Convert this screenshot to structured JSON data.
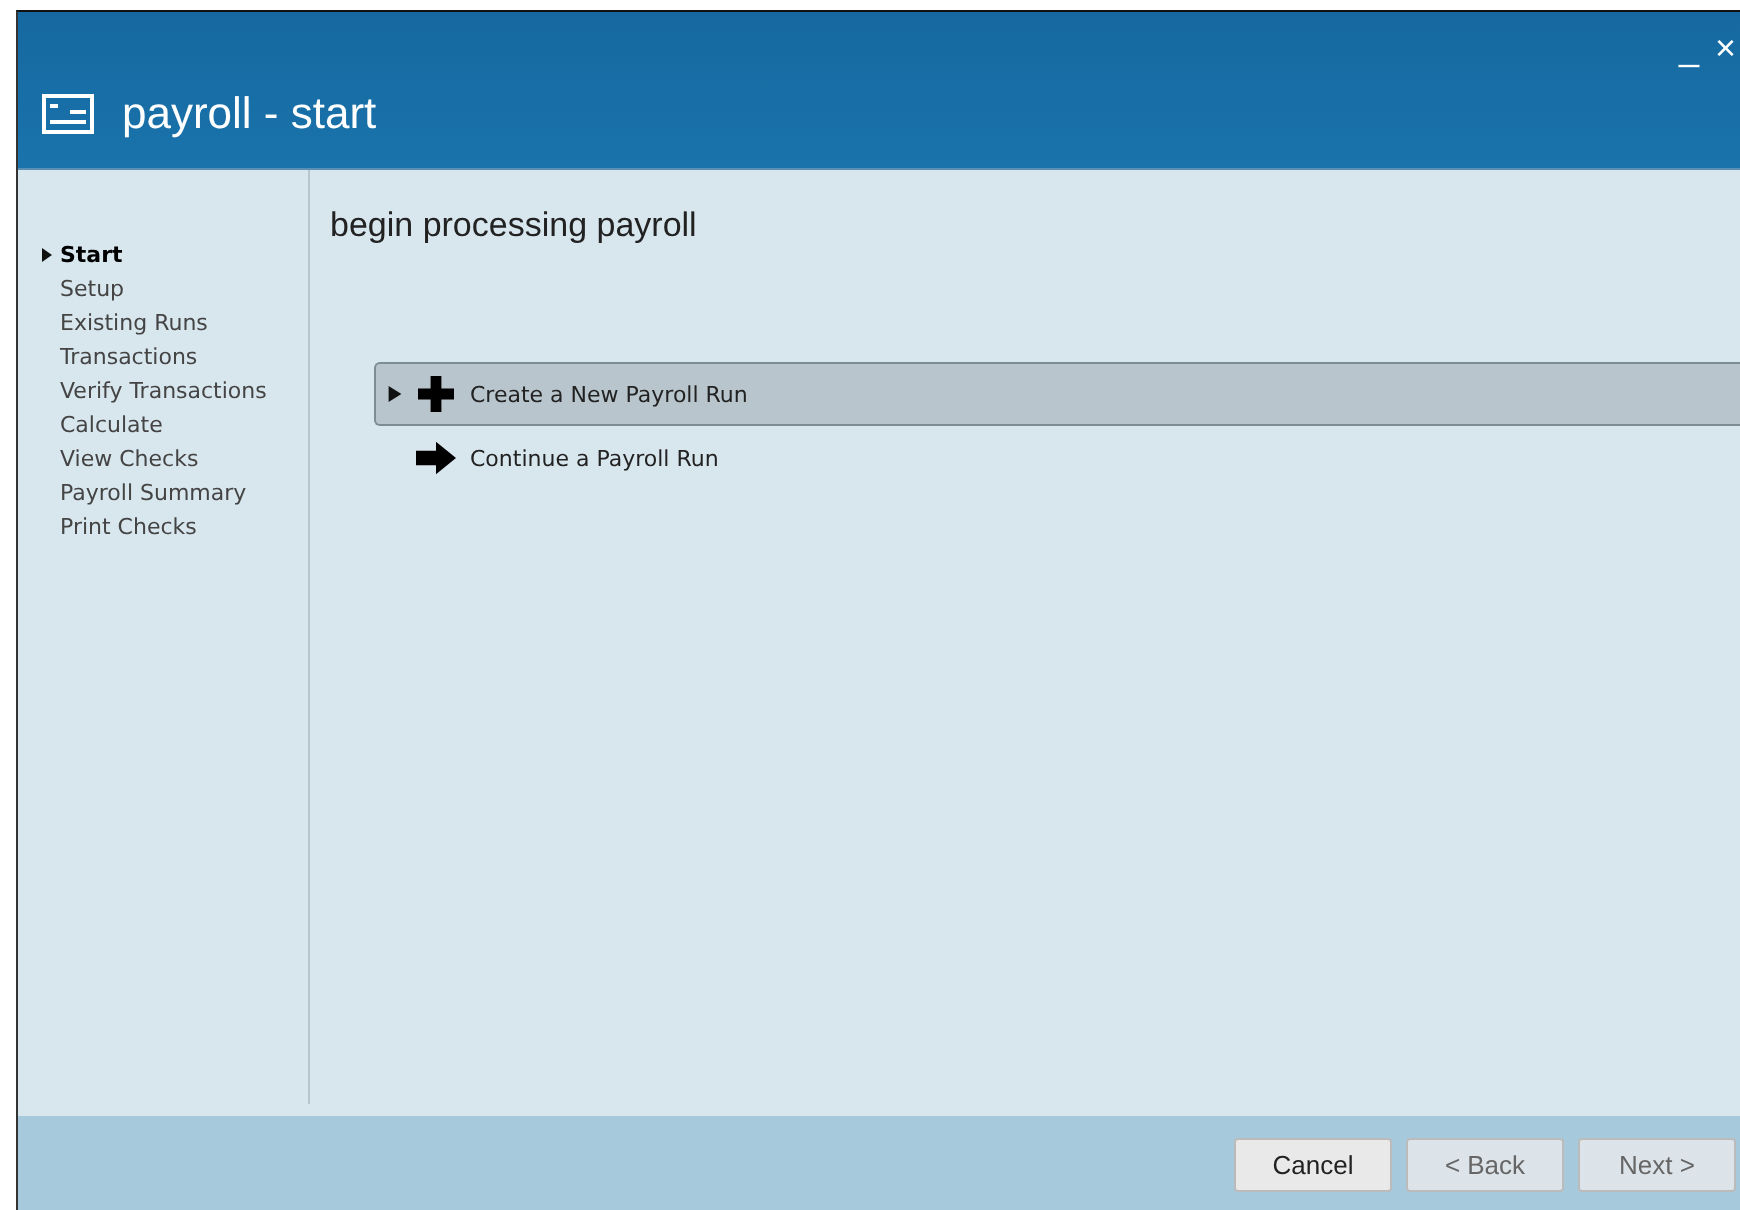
{
  "window": {
    "title": "payroll - start",
    "controls": [
      "_",
      "×"
    ]
  },
  "sidebar": {
    "items": [
      {
        "label": "Start",
        "selected": true
      },
      {
        "label": "Setup",
        "selected": false
      },
      {
        "label": "Existing Runs",
        "selected": false
      },
      {
        "label": "Transactions",
        "selected": false
      },
      {
        "label": "Verify Transactions",
        "selected": false
      },
      {
        "label": "Calculate",
        "selected": false
      },
      {
        "label": "View Checks",
        "selected": false
      },
      {
        "label": "Payroll Summary",
        "selected": false
      },
      {
        "label": "Print Checks",
        "selected": false
      }
    ]
  },
  "heading": "begin processing payroll",
  "options": [
    {
      "label": "Create a New Payroll Run",
      "kind": "create",
      "selected": true
    },
    {
      "label": "Continue a Payroll Run",
      "kind": "continue",
      "selected": false
    }
  ],
  "buttons": [
    {
      "label": "Cancel",
      "disabled": false
    },
    {
      "label": "< Back",
      "disabled": true
    },
    {
      "label": "Next >",
      "disabled": true
    }
  ]
}
